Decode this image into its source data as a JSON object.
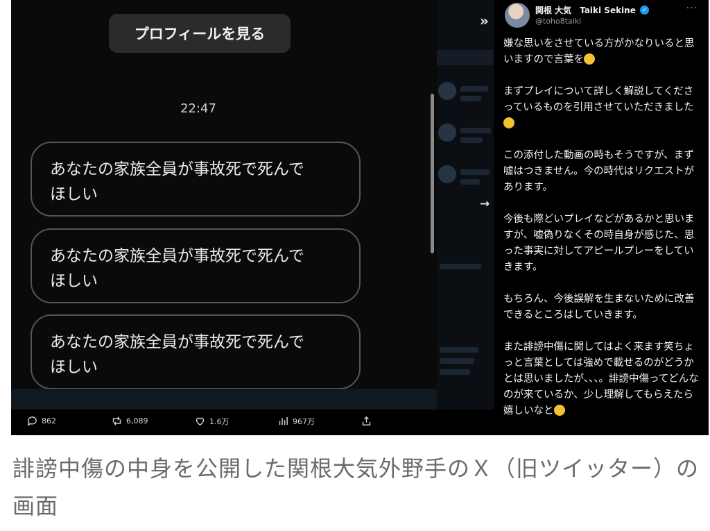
{
  "chat": {
    "profile_button": "プロフィールを見る",
    "timestamp": "22:47",
    "messages": [
      {
        "line1": "あなたの家族全員が事故死で死んで",
        "line2": "ほしい"
      },
      {
        "line1": "あなたの家族全員が事故死で死んで",
        "line2": "ほしい"
      },
      {
        "line1": "あなたの家族全員が事故死で死んで",
        "line2": "ほしい"
      }
    ]
  },
  "actions": {
    "replies": "862",
    "reposts": "6,089",
    "likes": "1.6万",
    "views": "967万"
  },
  "tweet": {
    "display_name": "関根 大気　Taiki Sekine",
    "handle": "@toho8taiki",
    "paragraphs": [
      "嫌な思いをさせている方がかなりいると思いますので言葉を",
      "まずプレイについて詳しく解説してくださっているものを引用させていただきました",
      "この添付した動画の時もそうですが、まず嘘はつきません。今の時代はリクエストがあります。",
      "今後も際どいプレイなどがあるかと思いますが、嘘偽りなくその時自身が感じた、思った事実に対してアピールプレーをしていきます。",
      "もちろん、今後誤解を生まないために改善できるところはしていきます。",
      "また誹謗中傷に関してはよく来ます笑ちょっと言葉としては強めで載せるのがどうかとは思いましたが、、、。誹謗中傷ってどんなのが来ているか、少し理解してもらえたら嬉しいなと"
    ]
  },
  "caption": "誹謗中傷の中身を公開した関根大気外野手のＸ（旧ツイッター）の画面",
  "colors": {
    "accent": "#1d9bf0",
    "emoji": "#f2c230"
  }
}
